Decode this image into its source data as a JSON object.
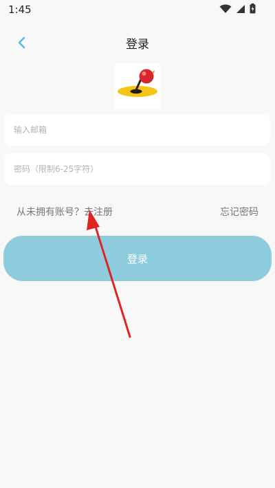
{
  "status_bar": {
    "time": "1:45",
    "icons": [
      "wifi-icon",
      "signal-icon",
      "battery-icon"
    ]
  },
  "header": {
    "title": "登录",
    "back_icon": "chevron-left-icon"
  },
  "logo": {
    "icon": "pin-hole-logo-icon"
  },
  "form": {
    "email_placeholder": "输入邮箱",
    "email_value": "",
    "password_placeholder": "密码（限制6-25字符）",
    "password_value": ""
  },
  "links": {
    "register": "从未拥有账号？去注册",
    "forgot_password": "忘记密码"
  },
  "login_button": {
    "label": "登录"
  },
  "colors": {
    "accent": "#8ecddd",
    "back_icon": "#5ab4e0",
    "annotation_arrow": "#e02424",
    "logo_red": "#d8262e",
    "logo_yellow": "#f4c515"
  }
}
